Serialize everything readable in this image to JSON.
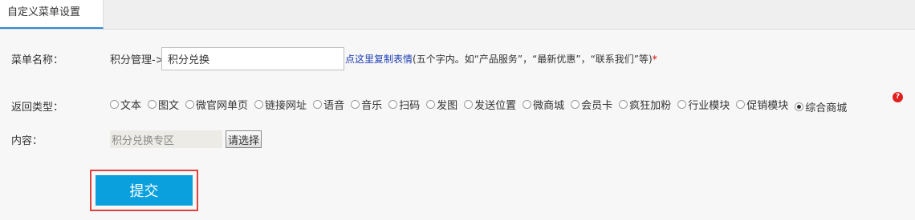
{
  "tab": {
    "label": "自定义菜单设置"
  },
  "menu_name": {
    "label": "菜单名称：",
    "prefix": "积分管理->",
    "value": "积分兑换",
    "hint_link": "点这里复制表情",
    "hint_text": "(五个字内。如“产品服务”，“最新优惠”，“联系我们”等)",
    "required_mark": "*"
  },
  "return_type": {
    "label": "返回类型：",
    "options": [
      "文本",
      "图文",
      "微官网单页",
      "链接网址",
      "语音",
      "音乐",
      "扫码",
      "发图",
      "发送位置",
      "微商城",
      "会员卡",
      "疯狂加粉",
      "行业模块",
      "促销模块",
      "综合商城"
    ],
    "selected": "综合商城",
    "help_icon_text": "?"
  },
  "content": {
    "label": "内容：",
    "value": "积分兑换专区",
    "choose_button": "请选择"
  },
  "submit_label": "提交",
  "colors": {
    "accent": "#0aa0de",
    "highlight_border": "#e0423d",
    "link": "#1f3fb5",
    "tab_underline": "#2d8bd6"
  }
}
